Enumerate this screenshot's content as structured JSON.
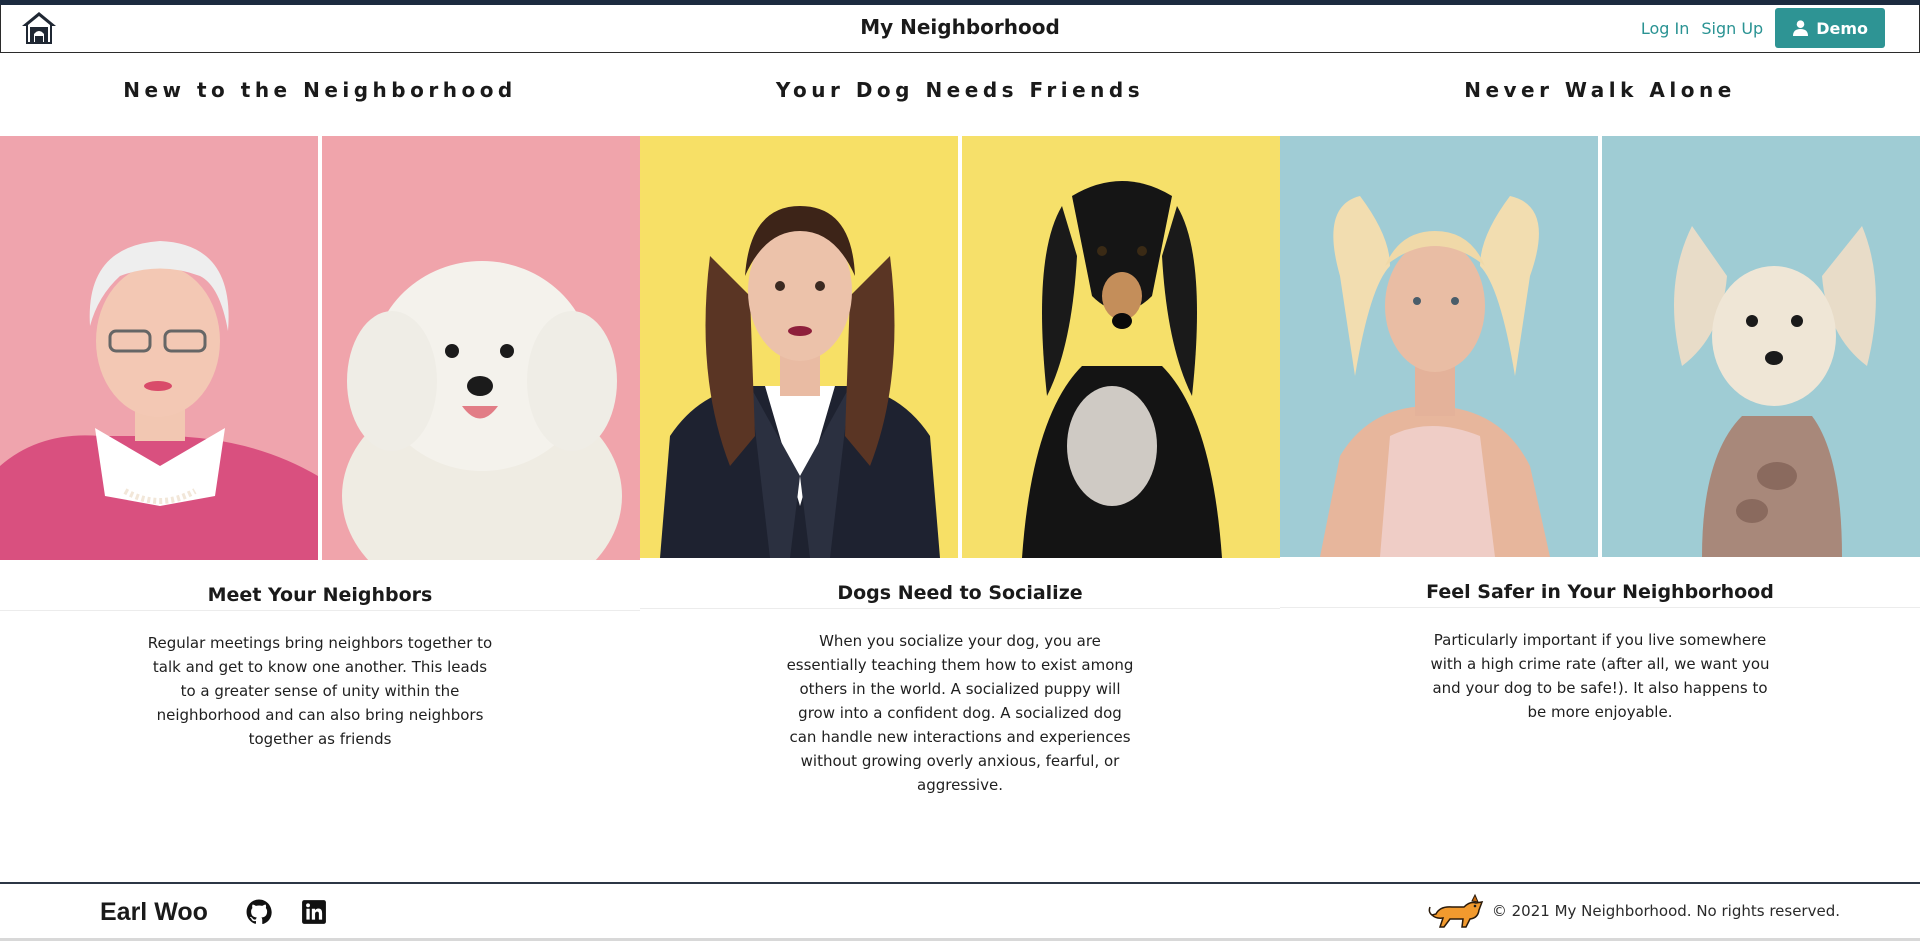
{
  "header": {
    "title": "My Neighborhood",
    "login_label": "Log In",
    "signup_label": "Sign Up",
    "demo_label": "Demo"
  },
  "columns": [
    {
      "heading": "New to the Neighborhood",
      "card_title": "Meet Your Neighbors",
      "card_text": "Regular meetings bring neighbors together to talk and get to know one another. This leads to a greater sense of unity within the neighborhood and can also bring neighbors together as friends",
      "photo_background": "#f0a6ae",
      "images": [
        "older-woman-portrait",
        "white-poodle-portrait"
      ]
    },
    {
      "heading": "Your Dog Needs Friends",
      "card_title": "Dogs Need to Socialize",
      "card_text": "When you socialize your dog, you are essentially teaching them how to exist among others in the world. A socialized puppy will grow into a confident dog. A socialized dog can handle new interactions and experiences without growing overly anxious, fearful, or aggressive.",
      "photo_background": "#f6e06a",
      "images": [
        "woman-pigtails-portrait",
        "black-saluki-portrait"
      ]
    },
    {
      "heading": "Never Walk Alone",
      "card_title": "Feel Safer in Your Neighborhood",
      "card_text": "Particularly important if you live somewhere with a high crime rate (after all, we want you and your dog to be safe!). It also happens to be more enjoyable.",
      "photo_background": "#9fcdd5",
      "images": [
        "blonde-woman-portrait",
        "crested-dog-portrait"
      ]
    }
  ],
  "footer": {
    "author": "Earl Woo",
    "copyright": "© 2021 My Neighborhood. No rights reserved."
  },
  "icons": [
    "home-icon",
    "user-icon",
    "github-icon",
    "linkedin-icon",
    "dog-logo-icon"
  ],
  "colors": {
    "accent": "#2e9494",
    "header_bar": "#1c2b3f"
  }
}
